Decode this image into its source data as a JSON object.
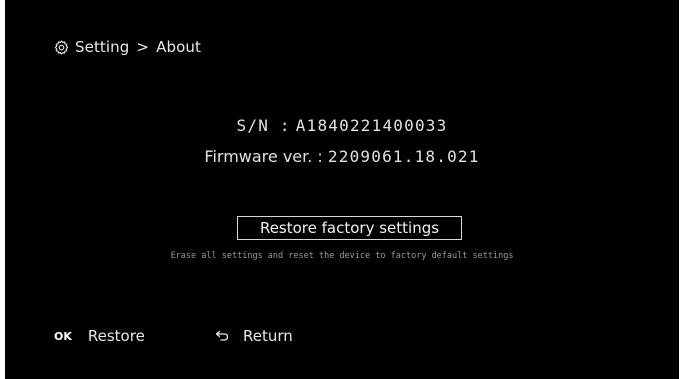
{
  "breadcrumb": {
    "icon": "gear-icon",
    "section": "Setting",
    "separator": ">",
    "page": "About"
  },
  "device": {
    "sn_label": "S/N :",
    "sn_value": "A1840221400033",
    "firmware_label": "Firmware ver. :",
    "firmware_value": "2209061.18.021"
  },
  "restore": {
    "button_label": "Restore factory settings",
    "hint": "Erase all settings and reset the device to factory default settings"
  },
  "footer": {
    "ok_key": "OK",
    "ok_action": "Restore",
    "return_icon": "return-arrow-icon",
    "return_action": "Return"
  },
  "colors": {
    "background": "#000000",
    "text": "#e8e8e8",
    "hint": "#9a9a9a",
    "page_margin": "#ffffff"
  }
}
